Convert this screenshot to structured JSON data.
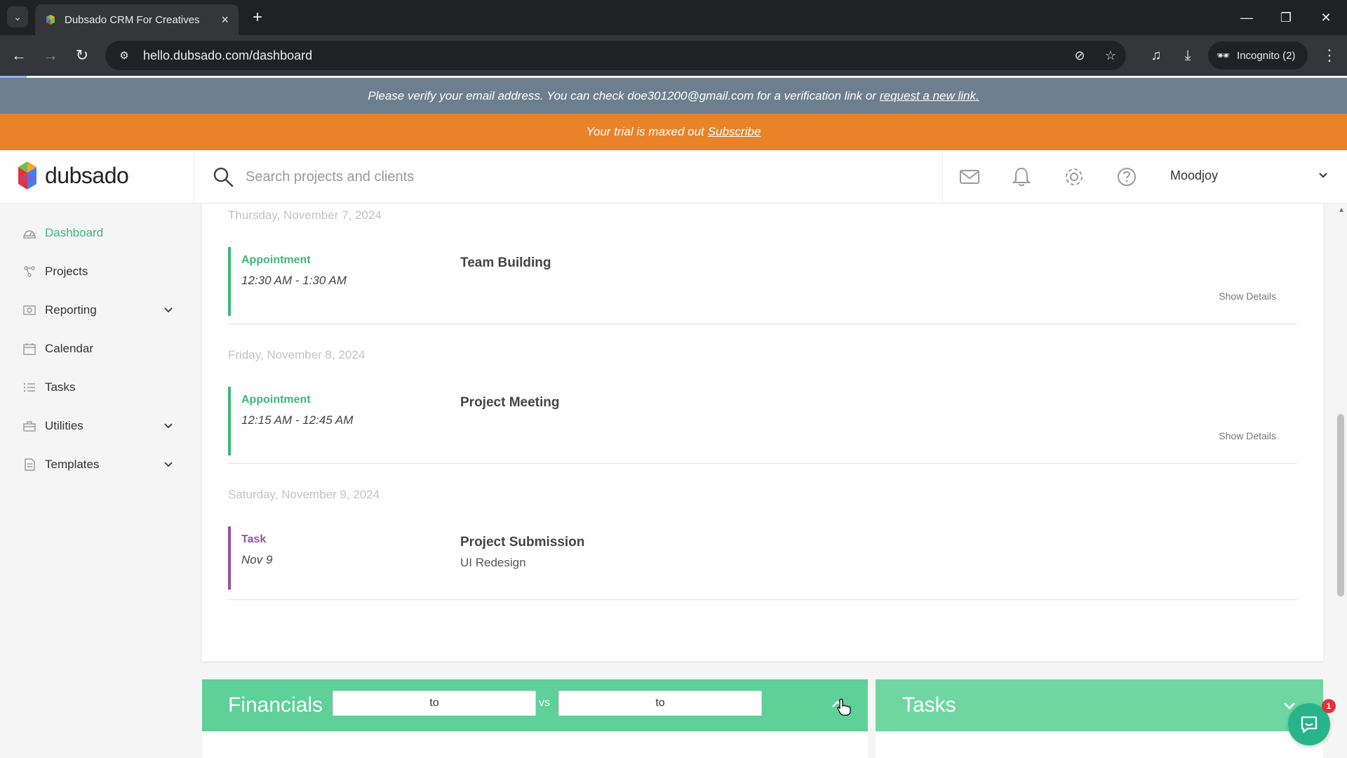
{
  "browser": {
    "tab_title": "Dubsado CRM For Creatives",
    "url": "hello.dubsado.com/dashboard",
    "incognito_label": "Incognito (2)",
    "icons": [
      "tab-search-icon",
      "dubsado-favicon",
      "close-icon",
      "plus-icon",
      "minimize-icon",
      "restore-icon",
      "window-close-icon",
      "back-icon",
      "forward-icon",
      "reload-icon",
      "site-info-icon",
      "eye-off-icon",
      "star-icon",
      "media-icon",
      "download-icon",
      "incognito-icon",
      "more-icon"
    ]
  },
  "banners": {
    "verify_text": "Please verify your email address. You can check doe301200@gmail.com for a verification link or",
    "verify_link": "request a new link.",
    "trial_text": "Your trial is maxed out",
    "trial_link": "Subscribe",
    "verify_bg": "#6d7f8e",
    "trial_bg": "#e8832a"
  },
  "header": {
    "logo_text": "dubsado",
    "search_placeholder": "Search projects and clients",
    "user_name": "Moodjoy"
  },
  "sidebar": {
    "items": [
      {
        "label": "Dashboard",
        "icon": "dashboard-icon",
        "active": true
      },
      {
        "label": "Projects",
        "icon": "projects-icon"
      },
      {
        "label": "Reporting",
        "icon": "reporting-icon",
        "has_chevron": true
      },
      {
        "label": "Calendar",
        "icon": "calendar-icon"
      },
      {
        "label": "Tasks",
        "icon": "tasks-icon"
      },
      {
        "label": "Utilities",
        "icon": "utilities-icon",
        "has_chevron": true
      },
      {
        "label": "Templates",
        "icon": "templates-icon",
        "has_chevron": true
      }
    ],
    "accent": "#3cb878"
  },
  "schedule": {
    "days": [
      {
        "date": "Thursday, November 7, 2024",
        "event": {
          "type": "Appointment",
          "time": "12:30 AM - 1:30 AM",
          "title": "Team Building",
          "show_details": "Show Details"
        }
      },
      {
        "date": "Friday, November 8, 2024",
        "event": {
          "type": "Appointment",
          "time": "12:15 AM - 12:45 AM",
          "title": "Project Meeting",
          "show_details": "Show Details"
        }
      },
      {
        "date": "Saturday, November 9, 2024",
        "event": {
          "type": "Task",
          "time": "Nov 9",
          "title": "Project Submission",
          "subtitle": "UI Redesign"
        }
      }
    ],
    "appointment_color": "#3cb878",
    "task_color": "#9b4fa5"
  },
  "financials": {
    "title": "Financials",
    "range1": "to",
    "vs_label": "vs",
    "range2": "to"
  },
  "tasks_panel": {
    "title": "Tasks"
  },
  "chat": {
    "badge_count": "1"
  }
}
